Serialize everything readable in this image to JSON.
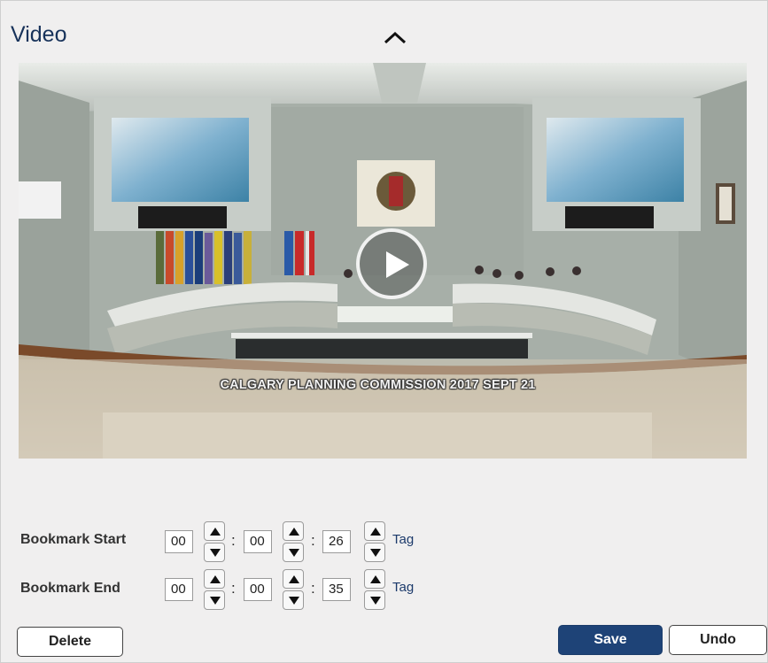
{
  "panel": {
    "title": "Video",
    "collapse_icon": "chevron-up-icon"
  },
  "video": {
    "caption": "CALGARY PLANNING COMMISSION 2017 SEPT 21",
    "play_icon": "play-icon"
  },
  "bookmark_start": {
    "label": "Bookmark Start",
    "hours": "00",
    "minutes": "00",
    "seconds": "26",
    "tag_label": "Tag"
  },
  "bookmark_end": {
    "label": "Bookmark End",
    "hours": "00",
    "minutes": "00",
    "seconds": "35",
    "tag_label": "Tag"
  },
  "time_separator": ":",
  "actions": {
    "delete_label": "Delete",
    "save_label": "Save",
    "undo_label": "Undo"
  },
  "colors": {
    "title": "#17325a",
    "save_button": "#1e4377",
    "tag_link": "#1c3a6b"
  }
}
